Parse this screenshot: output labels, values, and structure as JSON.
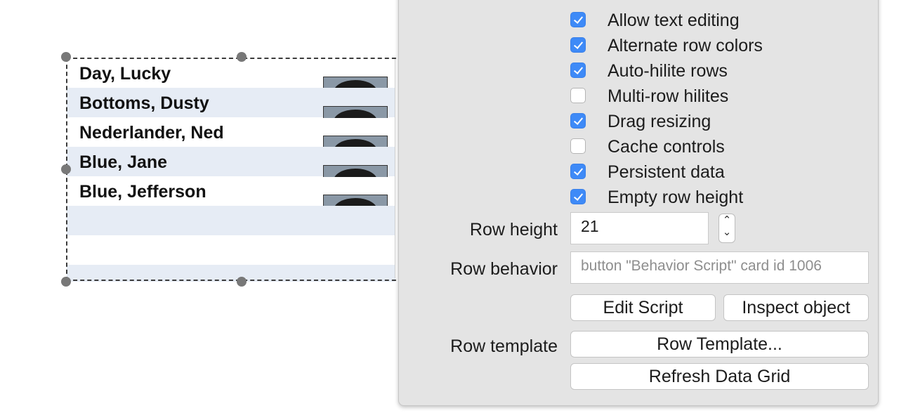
{
  "grid": {
    "rows": [
      {
        "name": "Day, Lucky"
      },
      {
        "name": "Bottoms, Dusty"
      },
      {
        "name": "Nederlander, Ned"
      },
      {
        "name": "Blue, Jane"
      },
      {
        "name": "Blue, Jefferson"
      }
    ],
    "alternate_row_color": "#e6ecf5"
  },
  "inspector": {
    "options": [
      {
        "label": "Allow text editing",
        "checked": true
      },
      {
        "label": "Alternate row colors",
        "checked": true
      },
      {
        "label": "Auto-hilite rows",
        "checked": true
      },
      {
        "label": "Multi-row hilites",
        "checked": false
      },
      {
        "label": "Drag resizing",
        "checked": true
      },
      {
        "label": "Cache controls",
        "checked": false
      },
      {
        "label": "Persistent data",
        "checked": true
      },
      {
        "label": "Empty row height",
        "checked": true
      }
    ],
    "row_height": {
      "label": "Row height",
      "value": "21"
    },
    "row_behavior": {
      "label": "Row behavior",
      "value": "button \"Behavior Script\" card  id 1006"
    },
    "buttons": {
      "edit_script": "Edit Script",
      "inspect_object": "Inspect object",
      "row_template": "Row Template...",
      "refresh": "Refresh Data Grid"
    },
    "row_template_label": "Row template",
    "checkbox_color": "#3e8af7"
  }
}
